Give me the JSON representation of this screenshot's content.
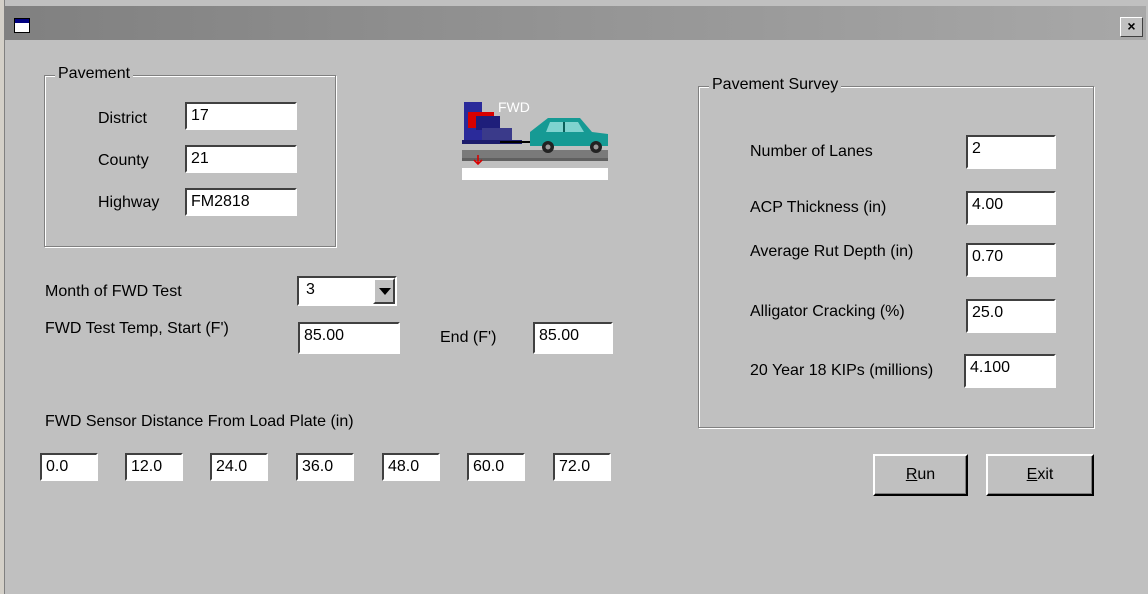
{
  "pavement": {
    "legend": "Pavement",
    "district_label": "District",
    "district_value": "17",
    "county_label": "County",
    "county_value": "21",
    "highway_label": "Highway",
    "highway_value": "FM2818"
  },
  "logo": {
    "text": "FWD"
  },
  "fwd_test": {
    "month_label": "Month of FWD Test",
    "month_value": "3",
    "temp_label": "FWD Test Temp,  Start  (F')",
    "start_value": "85.00",
    "end_label": "End  (F')",
    "end_value": "85.00"
  },
  "sensors": {
    "label": "FWD Sensor Distance From Load Plate  (in)",
    "values": [
      "0.0",
      "12.0",
      "24.0",
      "36.0",
      "48.0",
      "60.0",
      "72.0"
    ]
  },
  "survey": {
    "legend": "Pavement Survey",
    "lanes_label": "Number of Lanes",
    "lanes_value": "2",
    "acp_label": "ACP Thickness (in)",
    "acp_value": "4.00",
    "rut_label": "Average Rut Depth (in)",
    "rut_value": "0.70",
    "cracking_label": "Alligator Cracking (%)",
    "cracking_value": "25.0",
    "kips_label": "20 Year 18 KIPs (millions)",
    "kips_value": "4.100"
  },
  "buttons": {
    "run_mnemonic": "R",
    "run_rest": "un",
    "exit_mnemonic": "E",
    "exit_rest": "xit"
  },
  "titlebar": {
    "close_glyph": "×"
  }
}
